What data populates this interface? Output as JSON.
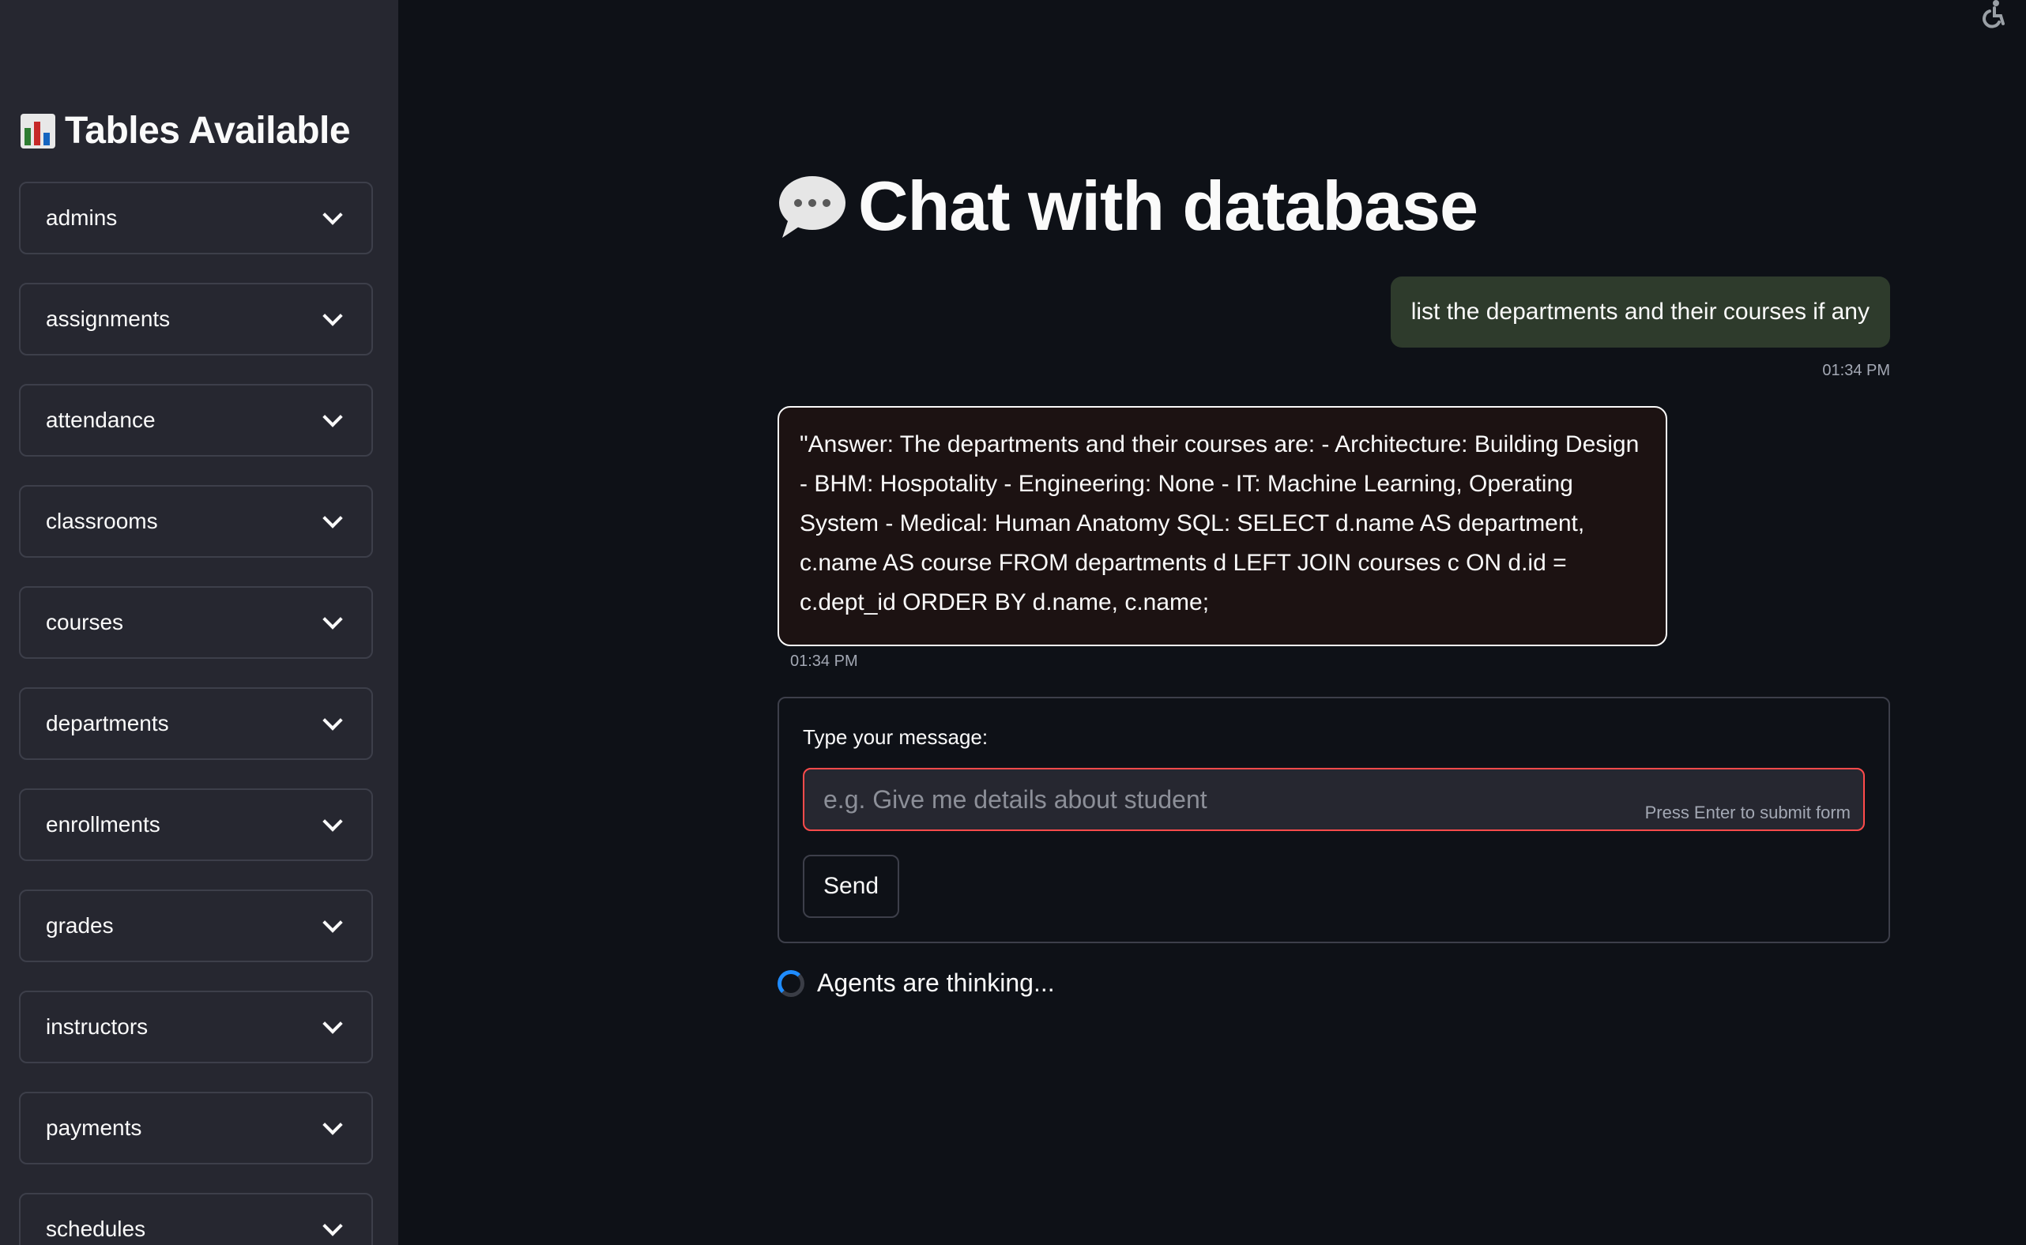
{
  "sidebar": {
    "title": "Tables Available",
    "title_icon": "bar-chart-emoji",
    "tables": [
      {
        "label": "admins"
      },
      {
        "label": "assignments"
      },
      {
        "label": "attendance"
      },
      {
        "label": "classrooms"
      },
      {
        "label": "courses"
      },
      {
        "label": "departments"
      },
      {
        "label": "enrollments"
      },
      {
        "label": "grades"
      },
      {
        "label": "instructors"
      },
      {
        "label": "payments"
      },
      {
        "label": "schedules"
      }
    ]
  },
  "header": {
    "title": "Chat with database",
    "title_icon": "speech-bubble-emoji"
  },
  "chat": {
    "user_message": "list the departments and their courses if any",
    "user_time": "01:34 PM",
    "bot_message": "\"Answer: The departments and their courses are: - Architecture: Building Design - BHM: Hospotality - Engineering: None - IT: Machine Learning, Operating System - Medical: Human Anatomy SQL: SELECT d.name AS department, c.name AS course FROM departments d LEFT JOIN courses c ON d.id = c.dept_id ORDER BY d.name, c.name;",
    "bot_time": "01:34 PM"
  },
  "form": {
    "label": "Type your message:",
    "placeholder": "e.g. Give me details about student",
    "value": "",
    "hint": "Press Enter to submit form",
    "send_label": "Send"
  },
  "status": {
    "text": "Agents are thinking..."
  },
  "colors": {
    "background": "#0e1117",
    "sidebar": "#262730",
    "user_bubble": "#2e3b2c",
    "bot_bubble": "#1c1212",
    "input_focus_border": "#ff4b4b",
    "spinner": "#1f8cff"
  }
}
